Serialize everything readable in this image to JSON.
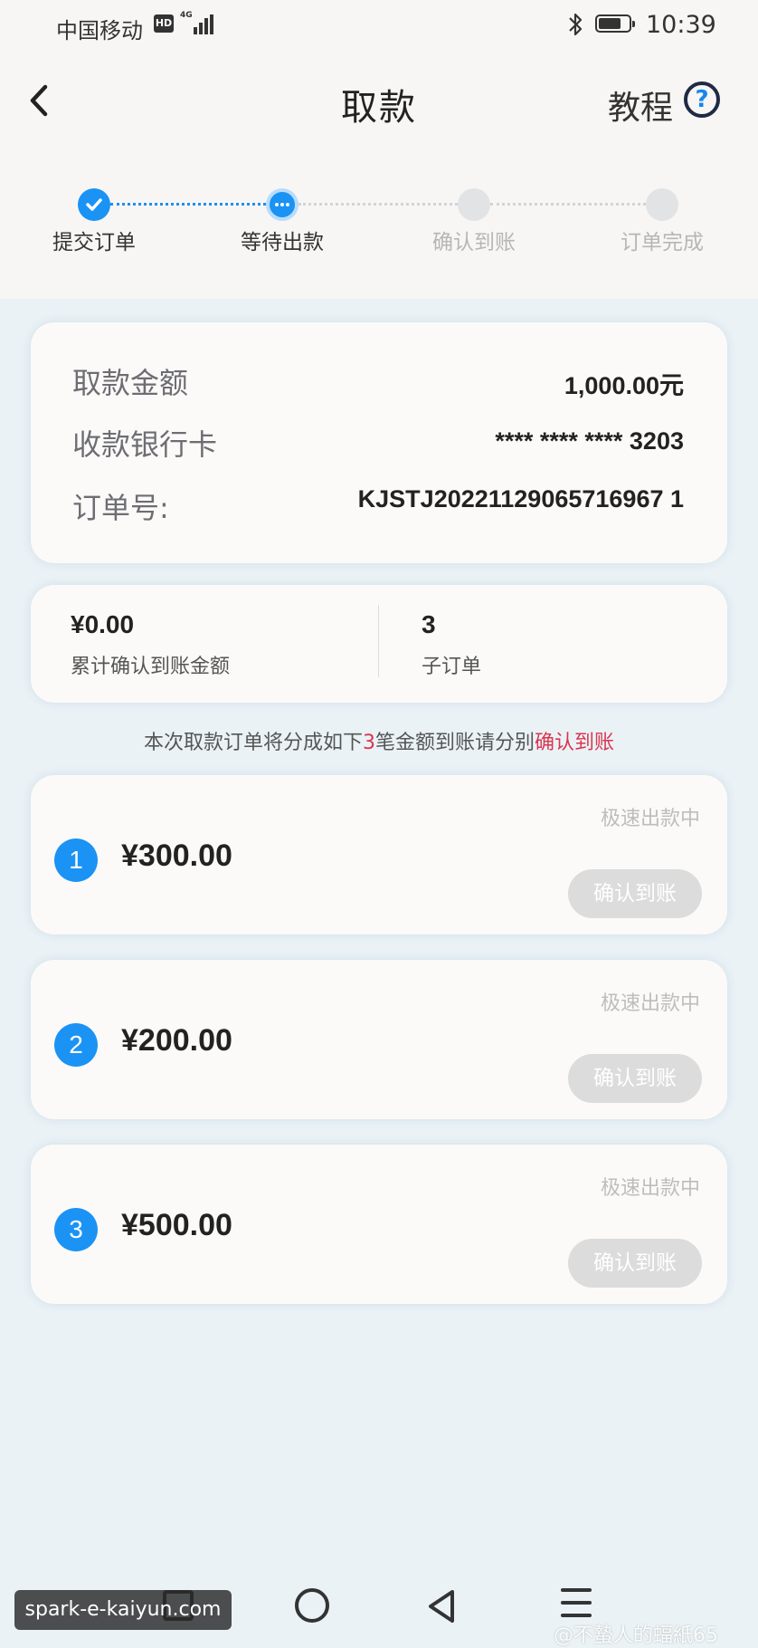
{
  "status_bar": {
    "carrier": "中国移动",
    "hd": "HD",
    "network": "4G",
    "time": "10:39"
  },
  "header": {
    "title": "取款",
    "tutorial": "教程",
    "help": "?"
  },
  "steps": [
    {
      "label": "提交订单",
      "state": "done"
    },
    {
      "label": "等待出款",
      "state": "active"
    },
    {
      "label": "确认到账",
      "state": "pending"
    },
    {
      "label": "订单完成",
      "state": "pending"
    }
  ],
  "info": {
    "amount_label": "取款金额",
    "amount_value": "1,000.00元",
    "card_label": "收款银行卡",
    "card_value": "**** **** **** 3203",
    "order_label": "订单号:",
    "order_value": "KJSTJ20221129065716967 1"
  },
  "summary": {
    "confirmed_amount": "¥0.00",
    "confirmed_caption": "累计确认到账金额",
    "sub_order_count": "3",
    "sub_order_caption": "子订单"
  },
  "notice": {
    "prefix": "本次取款订单将分成如下",
    "count": "3",
    "middle": "笔金额到账请分别",
    "action": "确认到账"
  },
  "orders": [
    {
      "index": "1",
      "amount": "¥300.00",
      "status": "极速出款中",
      "button": "确认到账"
    },
    {
      "index": "2",
      "amount": "¥200.00",
      "status": "极速出款中",
      "button": "确认到账"
    },
    {
      "index": "3",
      "amount": "¥500.00",
      "status": "极速出款中",
      "button": "确认到账"
    }
  ],
  "watermarks": {
    "left": "spark-e-kaiyun.com",
    "right": "@不蟄人的蝠紙65"
  },
  "colors": {
    "accent": "#1a93f5",
    "highlight": "#d9364f",
    "disabled": "#dcdcdc"
  }
}
